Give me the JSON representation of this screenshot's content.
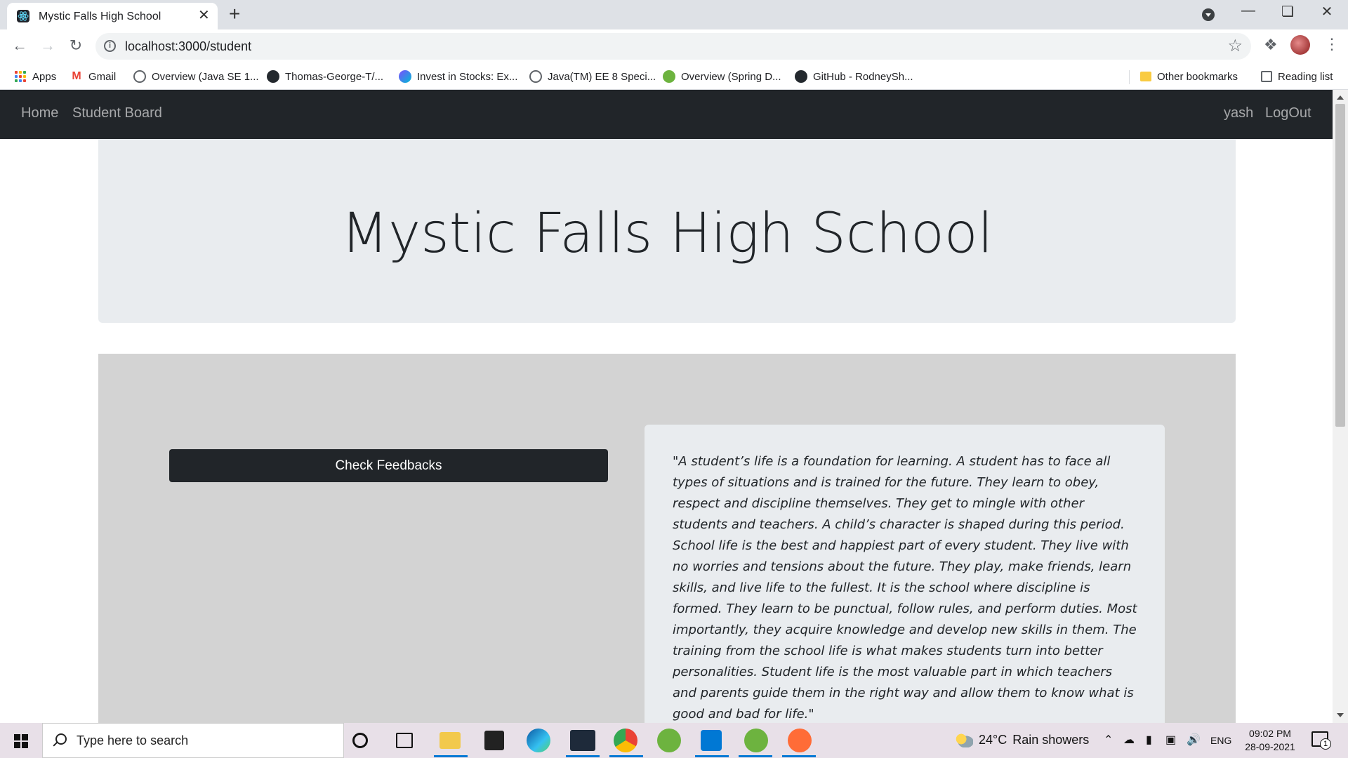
{
  "browser": {
    "tab_title": "Mystic Falls High School",
    "new_tab_symbol": "+",
    "close_symbol": "✕",
    "url": "localhost:3000/student",
    "bookmarks": [
      {
        "label": "Apps",
        "icon": "apps-grid-icon"
      },
      {
        "label": "Gmail",
        "icon": "gmail-icon"
      },
      {
        "label": "Overview (Java SE 1...",
        "icon": "globe-icon"
      },
      {
        "label": "Thomas-George-T/...",
        "icon": "github-icon"
      },
      {
        "label": "Invest in Stocks: Ex...",
        "icon": "invest-icon"
      },
      {
        "label": "Java(TM) EE 8 Speci...",
        "icon": "globe-icon"
      },
      {
        "label": "Overview (Spring D...",
        "icon": "spring-icon"
      },
      {
        "label": "GitHub - RodneySh...",
        "icon": "github-icon"
      }
    ],
    "other_bookmarks": "Other bookmarks",
    "reading_list": "Reading list"
  },
  "navbar": {
    "home": "Home",
    "student_board": "Student Board",
    "username": "yash",
    "logout": "LogOut"
  },
  "jumbotron": {
    "title": "Mystic Falls High School"
  },
  "main": {
    "feedback_button": "Check Feedbacks",
    "quote": "\"A student’s life is a foundation for learning. A student has to face all types of situations and is trained for the future. They learn to obey, respect and discipline themselves. They get to mingle with other students and teachers. A child’s character is shaped during this period. School life is the best and happiest part of every student. They live with no worries and tensions about the future. They play, make friends, learn skills, and live life to the fullest. It is the school where discipline is formed. They learn to be punctual, follow rules, and perform duties. Most importantly, they acquire knowledge and develop new skills in them. The training from the school life is what makes students turn into better personalities. Student life is the most valuable part in which teachers and parents guide them in the right way and allow them to know what is good and bad for life.\""
  },
  "taskbar": {
    "search_placeholder": "Type here to search",
    "temperature": "24°C",
    "weather": "Rain showers",
    "language": "ENG",
    "time": "09:02 PM",
    "date": "28-09-2021",
    "notification_count": "1"
  },
  "colors": {
    "navbar_bg": "#212529",
    "jumbotron_bg": "#e9ecef",
    "content_bg": "#d3d3d3",
    "button_bg": "#212529"
  }
}
